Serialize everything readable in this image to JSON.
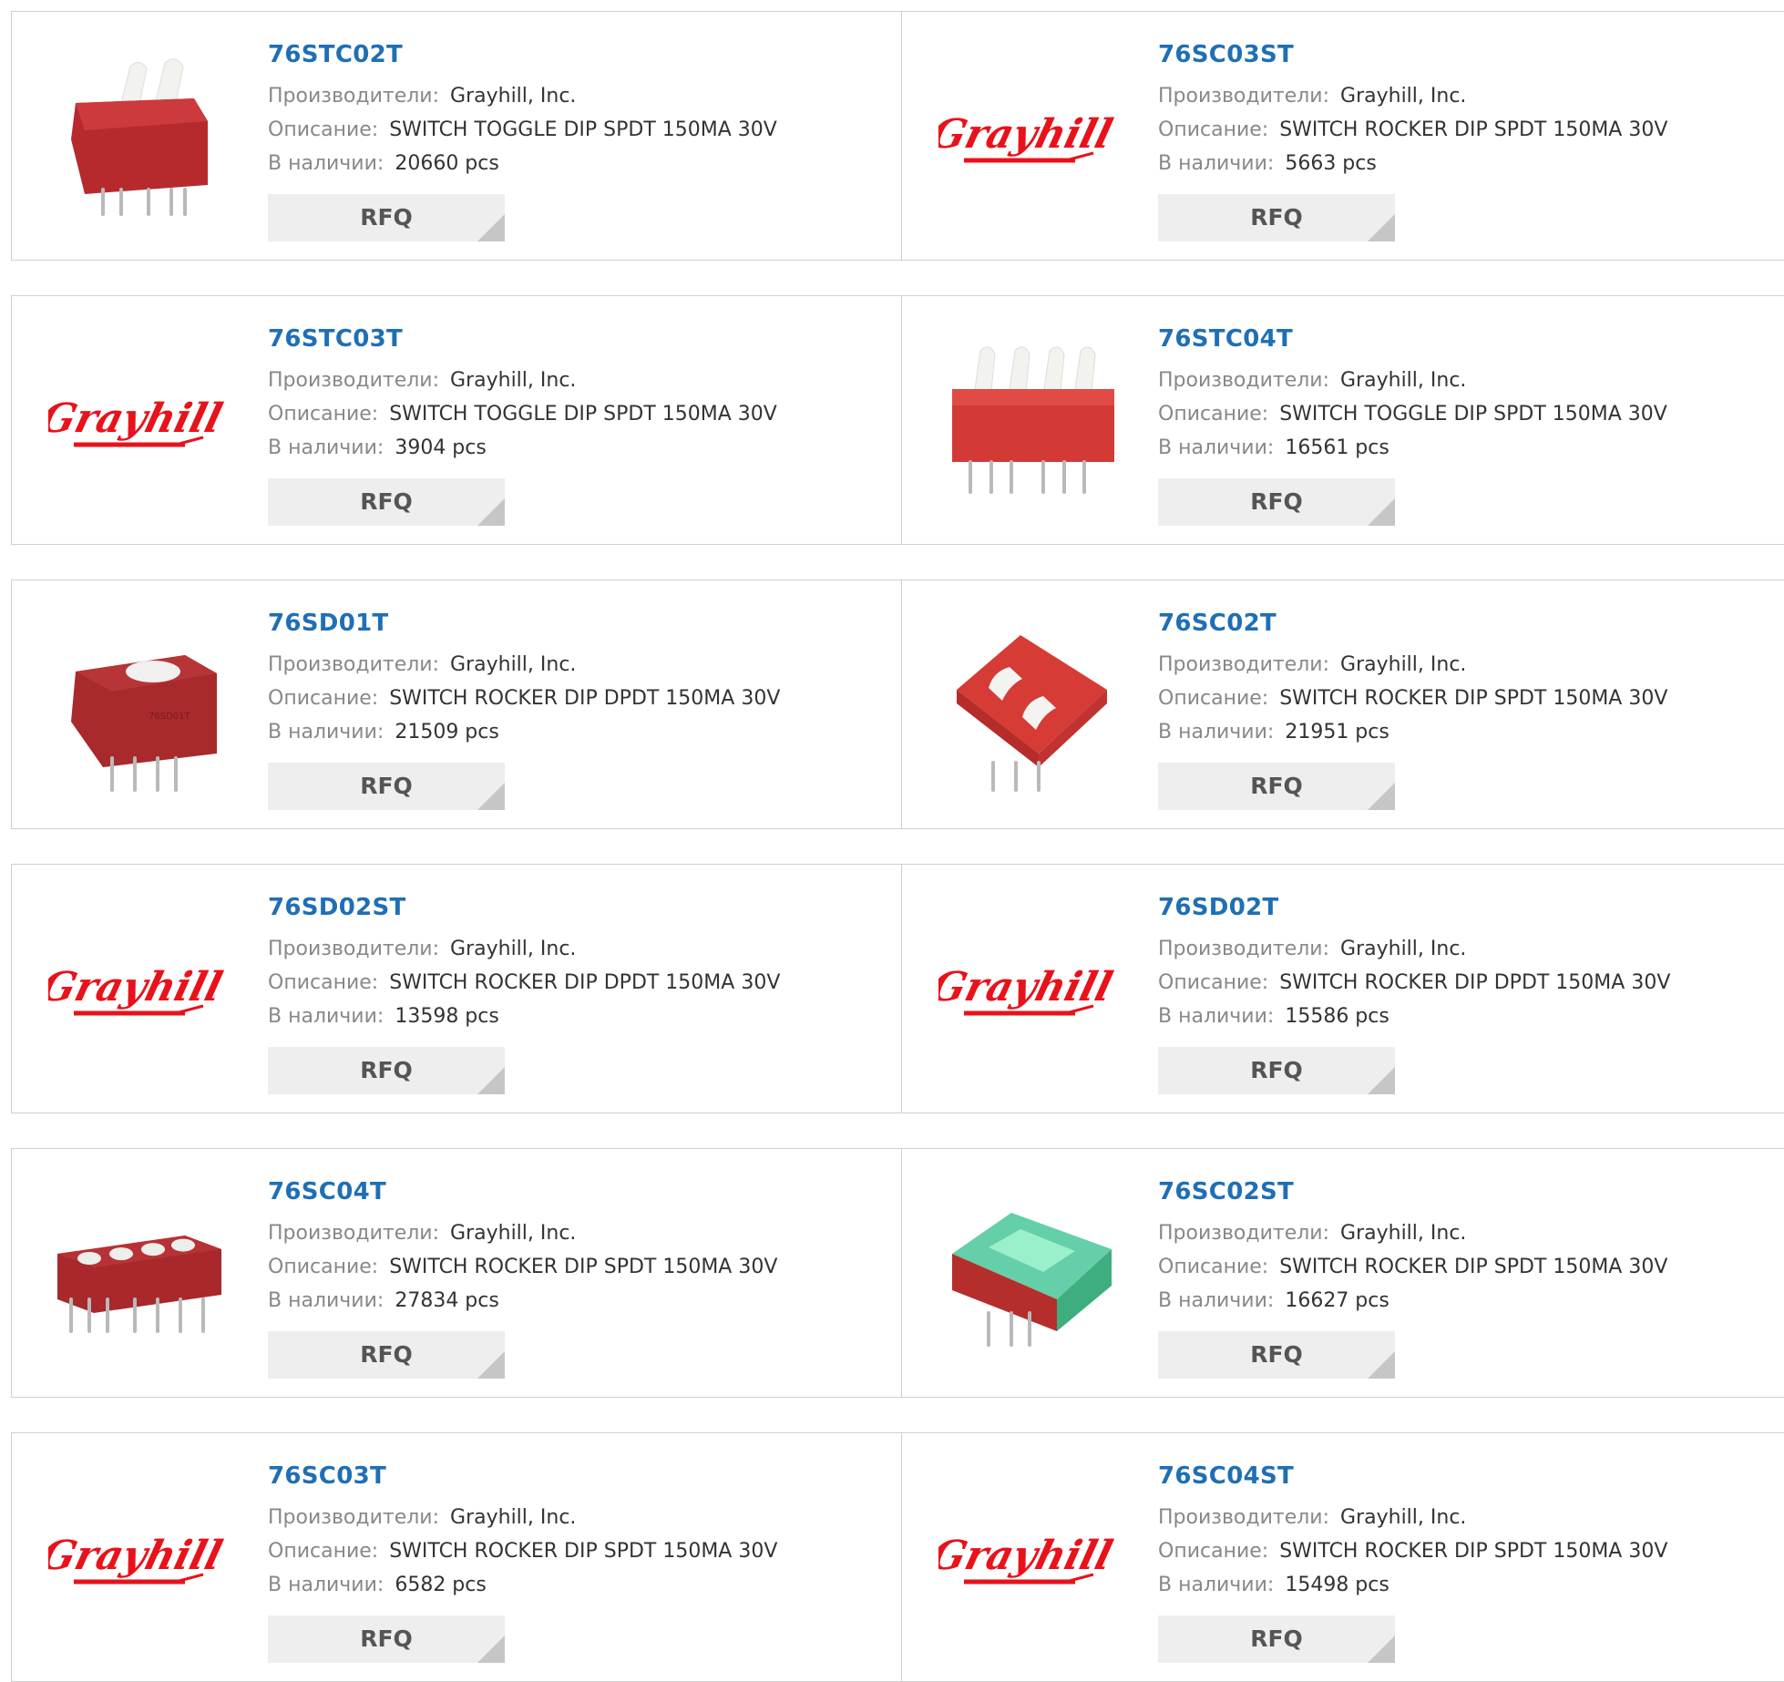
{
  "labels": {
    "manufacturer": "Производители:",
    "description": "Описание:",
    "stock": "В наличии:",
    "rfq": "RFQ"
  },
  "colors": {
    "part_link": "#1f6fb5",
    "button_bg": "#eeeeee",
    "logo_red": "#e8121b",
    "switch_red": "#c8282e"
  },
  "products": [
    {
      "part": "76STC02T",
      "manufacturer": "Grayhill, Inc.",
      "description": "SWITCH TOGGLE DIP SPDT 150MA 30V",
      "stock": "20660 pcs",
      "image": "toggle-switch-2pos-photo"
    },
    {
      "part": "76SC03ST",
      "manufacturer": "Grayhill, Inc.",
      "description": "SWITCH ROCKER DIP SPDT 150MA 30V",
      "stock": "5663 pcs",
      "image": "grayhill-logo"
    },
    {
      "part": "76STC03T",
      "manufacturer": "Grayhill, Inc.",
      "description": "SWITCH TOGGLE DIP SPDT 150MA 30V",
      "stock": "3904 pcs",
      "image": "grayhill-logo"
    },
    {
      "part": "76STC04T",
      "manufacturer": "Grayhill, Inc.",
      "description": "SWITCH TOGGLE DIP SPDT 150MA 30V",
      "stock": "16561 pcs",
      "image": "toggle-switch-4pos-photo"
    },
    {
      "part": "76SD01T",
      "manufacturer": "Grayhill, Inc.",
      "description": "SWITCH ROCKER DIP DPDT 150MA 30V",
      "stock": "21509 pcs",
      "image": "rocker-switch-1pos-photo"
    },
    {
      "part": "76SC02T",
      "manufacturer": "Grayhill, Inc.",
      "description": "SWITCH ROCKER DIP SPDT 150MA 30V",
      "stock": "21951 pcs",
      "image": "rocker-switch-2pos-photo"
    },
    {
      "part": "76SD02ST",
      "manufacturer": "Grayhill, Inc.",
      "description": "SWITCH ROCKER DIP DPDT 150MA 30V",
      "stock": "13598 pcs",
      "image": "grayhill-logo"
    },
    {
      "part": "76SD02T",
      "manufacturer": "Grayhill, Inc.",
      "description": "SWITCH ROCKER DIP DPDT 150MA 30V",
      "stock": "15586 pcs",
      "image": "grayhill-logo"
    },
    {
      "part": "76SC04T",
      "manufacturer": "Grayhill, Inc.",
      "description": "SWITCH ROCKER DIP SPDT 150MA 30V",
      "stock": "27834 pcs",
      "image": "rocker-switch-4pos-photo"
    },
    {
      "part": "76SC02ST",
      "manufacturer": "Grayhill, Inc.",
      "description": "SWITCH ROCKER DIP SPDT 150MA 30V",
      "stock": "16627 pcs",
      "image": "rocker-switch-sealed-photo"
    },
    {
      "part": "76SC03T",
      "manufacturer": "Grayhill, Inc.",
      "description": "SWITCH ROCKER DIP SPDT 150MA 30V",
      "stock": "6582 pcs",
      "image": "grayhill-logo"
    },
    {
      "part": "76SC04ST",
      "manufacturer": "Grayhill, Inc.",
      "description": "SWITCH ROCKER DIP SPDT 150MA 30V",
      "stock": "15498 pcs",
      "image": "grayhill-logo"
    }
  ]
}
